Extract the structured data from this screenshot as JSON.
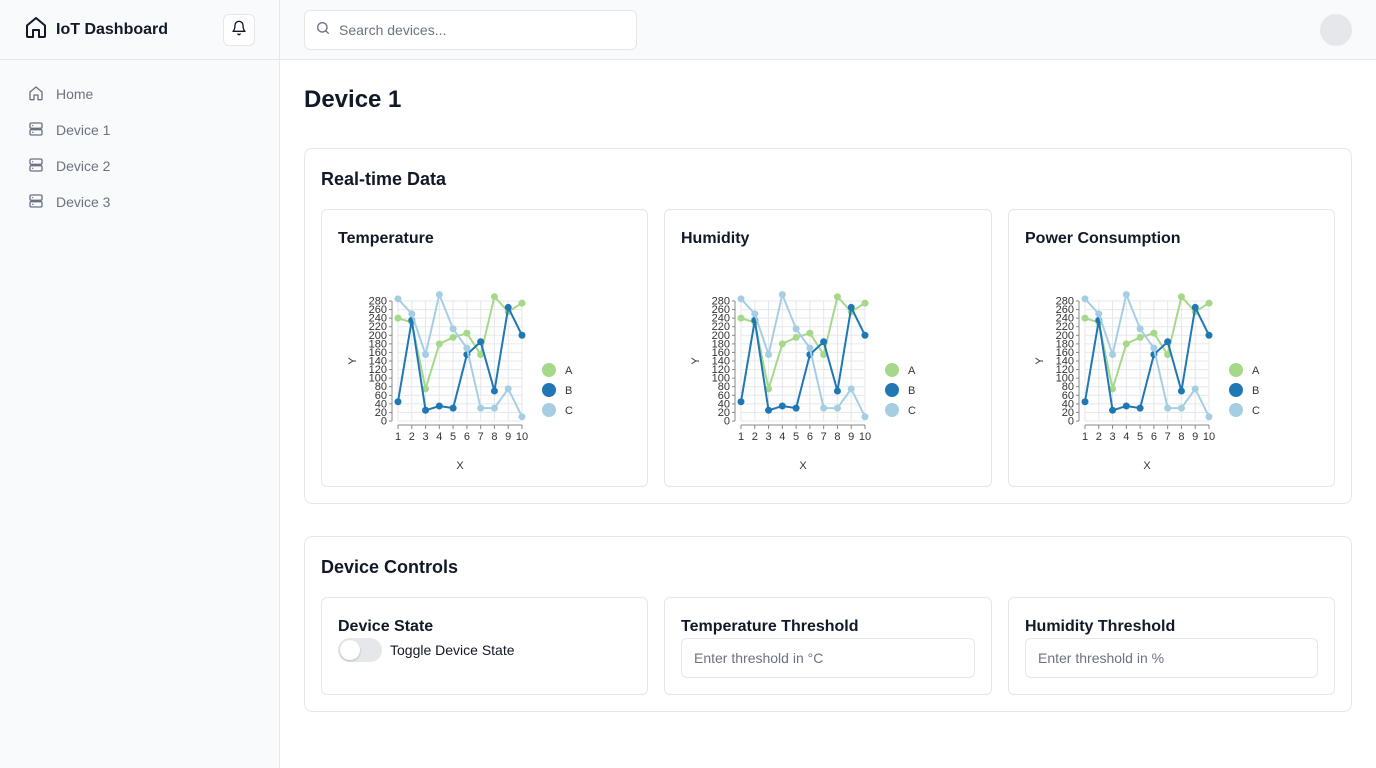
{
  "app": {
    "title": "IoT Dashboard"
  },
  "search": {
    "placeholder": "Search devices..."
  },
  "sidebar": {
    "items": [
      {
        "label": "Home",
        "icon": "home-icon"
      },
      {
        "label": "Device 1",
        "icon": "server-icon"
      },
      {
        "label": "Device 2",
        "icon": "server-icon"
      },
      {
        "label": "Device 3",
        "icon": "server-icon"
      }
    ]
  },
  "page": {
    "title": "Device 1"
  },
  "realtime": {
    "title": "Real-time Data"
  },
  "charts_meta": [
    {
      "title": "Temperature"
    },
    {
      "title": "Humidity"
    },
    {
      "title": "Power Consumption"
    }
  ],
  "colors": {
    "A": "#a6d88a",
    "B": "#1f77b4",
    "C": "#a6cee3"
  },
  "chart_data": [
    {
      "type": "line",
      "title": "Temperature",
      "xlabel": "X",
      "ylabel": "Y",
      "x": [
        1,
        2,
        3,
        4,
        5,
        6,
        7,
        8,
        9,
        10
      ],
      "yticks": [
        0,
        20,
        40,
        60,
        80,
        100,
        120,
        140,
        160,
        180,
        200,
        220,
        240,
        260,
        280
      ],
      "ylim": [
        0,
        280
      ],
      "legend": "right",
      "grid": true,
      "series": [
        {
          "name": "A",
          "values": [
            240,
            230,
            75,
            180,
            195,
            205,
            155,
            290,
            255,
            275
          ]
        },
        {
          "name": "B",
          "values": [
            45,
            235,
            25,
            35,
            30,
            155,
            185,
            70,
            265,
            200
          ]
        },
        {
          "name": "C",
          "values": [
            285,
            250,
            155,
            295,
            215,
            170,
            30,
            30,
            75,
            10
          ]
        }
      ]
    },
    {
      "type": "line",
      "title": "Humidity",
      "xlabel": "X",
      "ylabel": "Y",
      "x": [
        1,
        2,
        3,
        4,
        5,
        6,
        7,
        8,
        9,
        10
      ],
      "yticks": [
        0,
        20,
        40,
        60,
        80,
        100,
        120,
        140,
        160,
        180,
        200,
        220,
        240,
        260,
        280
      ],
      "ylim": [
        0,
        280
      ],
      "legend": "right",
      "grid": true,
      "series": [
        {
          "name": "A",
          "values": [
            240,
            230,
            75,
            180,
            195,
            205,
            155,
            290,
            255,
            275
          ]
        },
        {
          "name": "B",
          "values": [
            45,
            235,
            25,
            35,
            30,
            155,
            185,
            70,
            265,
            200
          ]
        },
        {
          "name": "C",
          "values": [
            285,
            250,
            155,
            295,
            215,
            170,
            30,
            30,
            75,
            10
          ]
        }
      ]
    },
    {
      "type": "line",
      "title": "Power Consumption",
      "xlabel": "X",
      "ylabel": "Y",
      "x": [
        1,
        2,
        3,
        4,
        5,
        6,
        7,
        8,
        9,
        10
      ],
      "yticks": [
        0,
        20,
        40,
        60,
        80,
        100,
        120,
        140,
        160,
        180,
        200,
        220,
        240,
        260,
        280
      ],
      "ylim": [
        0,
        280
      ],
      "legend": "right",
      "grid": true,
      "series": [
        {
          "name": "A",
          "values": [
            240,
            230,
            75,
            180,
            195,
            205,
            155,
            290,
            255,
            275
          ]
        },
        {
          "name": "B",
          "values": [
            45,
            235,
            25,
            35,
            30,
            155,
            185,
            70,
            265,
            200
          ]
        },
        {
          "name": "C",
          "values": [
            285,
            250,
            155,
            295,
            215,
            170,
            30,
            30,
            75,
            10
          ]
        }
      ]
    }
  ],
  "controls": {
    "title": "Device Controls",
    "device_state": {
      "title": "Device State",
      "toggle_label": "Toggle Device State",
      "on": false
    },
    "temp_threshold": {
      "title": "Temperature Threshold",
      "placeholder": "Enter threshold in °C"
    },
    "humidity_threshold": {
      "title": "Humidity Threshold",
      "placeholder": "Enter threshold in %"
    }
  }
}
